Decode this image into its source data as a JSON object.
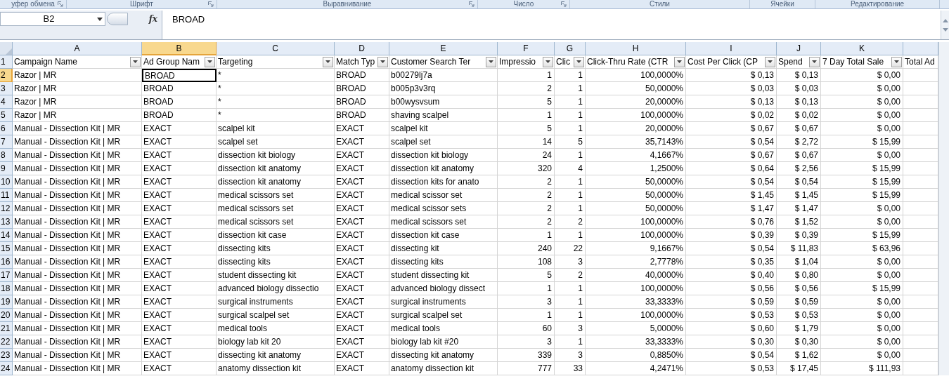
{
  "ribbon_groups": [
    {
      "label": "уфер обмена",
      "launcher": true
    },
    {
      "label": "Шрифт",
      "launcher": true
    },
    {
      "label": "Выравнивание",
      "launcher": true
    },
    {
      "label": "Число",
      "launcher": true
    },
    {
      "label": "Стили",
      "launcher": false
    },
    {
      "label": "Ячейки",
      "launcher": false
    },
    {
      "label": "Редактирование",
      "launcher": false
    }
  ],
  "formula_bar": {
    "name_box": "B2",
    "fx": "fx",
    "formula": "BROAD"
  },
  "columns": [
    {
      "letter": "A",
      "selected": false
    },
    {
      "letter": "B",
      "selected": true
    },
    {
      "letter": "C",
      "selected": false
    },
    {
      "letter": "D",
      "selected": false
    },
    {
      "letter": "E",
      "selected": false
    },
    {
      "letter": "F",
      "selected": false
    },
    {
      "letter": "G",
      "selected": false
    },
    {
      "letter": "H",
      "selected": false
    },
    {
      "letter": "I",
      "selected": false
    },
    {
      "letter": "J",
      "selected": false
    },
    {
      "letter": "K",
      "selected": false
    }
  ],
  "header_row": {
    "number": "1",
    "cells": [
      "Campaign Name",
      "Ad Group Nam",
      "Targeting",
      "Match Typ",
      "Customer Search Ter",
      "Impressio",
      "Clic",
      "Click-Thru Rate (CTR",
      "Cost Per Click (CP",
      "Spend",
      "7 Day Total Sale",
      "Total Ad"
    ]
  },
  "rows": [
    {
      "number": "2",
      "selected": true,
      "cells": [
        "Razor | MR",
        "BROAD",
        "*",
        "BROAD",
        "b00279lj7a",
        "1",
        "1",
        "100,0000%",
        "$ 0,13",
        "$ 0,13",
        "$ 0,00"
      ]
    },
    {
      "number": "3",
      "selected": false,
      "cells": [
        "Razor | MR",
        "BROAD",
        "*",
        "BROAD",
        "b005p3v3rq",
        "2",
        "1",
        "50,0000%",
        "$ 0,03",
        "$ 0,03",
        "$ 0,00"
      ]
    },
    {
      "number": "4",
      "selected": false,
      "cells": [
        "Razor | MR",
        "BROAD",
        "*",
        "BROAD",
        "b00wysvsum",
        "5",
        "1",
        "20,0000%",
        "$ 0,13",
        "$ 0,13",
        "$ 0,00"
      ]
    },
    {
      "number": "5",
      "selected": false,
      "cells": [
        "Razor | MR",
        "BROAD",
        "*",
        "BROAD",
        "shaving scalpel",
        "1",
        "1",
        "100,0000%",
        "$ 0,02",
        "$ 0,02",
        "$ 0,00"
      ]
    },
    {
      "number": "6",
      "selected": false,
      "cells": [
        "Manual - Dissection Kit | MR",
        "EXACT",
        "scalpel kit",
        "EXACT",
        "scalpel kit",
        "5",
        "1",
        "20,0000%",
        "$ 0,67",
        "$ 0,67",
        "$ 0,00"
      ]
    },
    {
      "number": "7",
      "selected": false,
      "cells": [
        "Manual - Dissection Kit | MR",
        "EXACT",
        "scalpel set",
        "EXACT",
        "scalpel set",
        "14",
        "5",
        "35,7143%",
        "$ 0,54",
        "$ 2,72",
        "$ 15,99"
      ]
    },
    {
      "number": "8",
      "selected": false,
      "cells": [
        "Manual - Dissection Kit | MR",
        "EXACT",
        "dissection kit biology",
        "EXACT",
        "dissection kit biology",
        "24",
        "1",
        "4,1667%",
        "$ 0,67",
        "$ 0,67",
        "$ 0,00"
      ]
    },
    {
      "number": "9",
      "selected": false,
      "cells": [
        "Manual - Dissection Kit | MR",
        "EXACT",
        "dissection kit anatomy",
        "EXACT",
        "dissection kit anatomy",
        "320",
        "4",
        "1,2500%",
        "$ 0,64",
        "$ 2,56",
        "$ 15,99"
      ]
    },
    {
      "number": "10",
      "selected": false,
      "cells": [
        "Manual - Dissection Kit | MR",
        "EXACT",
        "dissection kit anatomy",
        "EXACT",
        "dissection kits for anato",
        "2",
        "1",
        "50,0000%",
        "$ 0,54",
        "$ 0,54",
        "$ 15,99"
      ]
    },
    {
      "number": "11",
      "selected": false,
      "cells": [
        "Manual - Dissection Kit | MR",
        "EXACT",
        "medical scissors set",
        "EXACT",
        "medical scissor set",
        "2",
        "1",
        "50,0000%",
        "$ 1,45",
        "$ 1,45",
        "$ 15,99"
      ]
    },
    {
      "number": "12",
      "selected": false,
      "cells": [
        "Manual - Dissection Kit | MR",
        "EXACT",
        "medical scissors set",
        "EXACT",
        "medical scissor sets",
        "2",
        "1",
        "50,0000%",
        "$ 1,47",
        "$ 1,47",
        "$ 0,00"
      ]
    },
    {
      "number": "13",
      "selected": false,
      "cells": [
        "Manual - Dissection Kit | MR",
        "EXACT",
        "medical scissors set",
        "EXACT",
        "medical scissors set",
        "2",
        "2",
        "100,0000%",
        "$ 0,76",
        "$ 1,52",
        "$ 0,00"
      ]
    },
    {
      "number": "14",
      "selected": false,
      "cells": [
        "Manual - Dissection Kit | MR",
        "EXACT",
        "dissection kit case",
        "EXACT",
        "dissection kit case",
        "1",
        "1",
        "100,0000%",
        "$ 0,39",
        "$ 0,39",
        "$ 15,99"
      ]
    },
    {
      "number": "15",
      "selected": false,
      "cells": [
        "Manual - Dissection Kit | MR",
        "EXACT",
        "dissecting kits",
        "EXACT",
        "dissecting kit",
        "240",
        "22",
        "9,1667%",
        "$ 0,54",
        "$ 11,83",
        "$ 63,96"
      ]
    },
    {
      "number": "16",
      "selected": false,
      "cells": [
        "Manual - Dissection Kit | MR",
        "EXACT",
        "dissecting kits",
        "EXACT",
        "dissecting kits",
        "108",
        "3",
        "2,7778%",
        "$ 0,35",
        "$ 1,04",
        "$ 0,00"
      ]
    },
    {
      "number": "17",
      "selected": false,
      "cells": [
        "Manual - Dissection Kit | MR",
        "EXACT",
        "student dissecting kit",
        "EXACT",
        "student dissecting kit",
        "5",
        "2",
        "40,0000%",
        "$ 0,40",
        "$ 0,80",
        "$ 0,00"
      ]
    },
    {
      "number": "18",
      "selected": false,
      "cells": [
        "Manual - Dissection Kit | MR",
        "EXACT",
        "advanced biology dissectio",
        "EXACT",
        "advanced biology dissect",
        "1",
        "1",
        "100,0000%",
        "$ 0,56",
        "$ 0,56",
        "$ 15,99"
      ]
    },
    {
      "number": "19",
      "selected": false,
      "cells": [
        "Manual - Dissection Kit | MR",
        "EXACT",
        "surgical instruments",
        "EXACT",
        "surgical instruments",
        "3",
        "1",
        "33,3333%",
        "$ 0,59",
        "$ 0,59",
        "$ 0,00"
      ]
    },
    {
      "number": "20",
      "selected": false,
      "cells": [
        "Manual - Dissection Kit | MR",
        "EXACT",
        "surgical scalpel set",
        "EXACT",
        "surgical scalpel set",
        "1",
        "1",
        "100,0000%",
        "$ 0,53",
        "$ 0,53",
        "$ 0,00"
      ]
    },
    {
      "number": "21",
      "selected": false,
      "cells": [
        "Manual - Dissection Kit | MR",
        "EXACT",
        "medical tools",
        "EXACT",
        "medical tools",
        "60",
        "3",
        "5,0000%",
        "$ 0,60",
        "$ 1,79",
        "$ 0,00"
      ]
    },
    {
      "number": "22",
      "selected": false,
      "cells": [
        "Manual - Dissection Kit | MR",
        "EXACT",
        "biology lab kit 20",
        "EXACT",
        "biology lab kit #20",
        "3",
        "1",
        "33,3333%",
        "$ 0,30",
        "$ 0,30",
        "$ 0,00"
      ]
    },
    {
      "number": "23",
      "selected": false,
      "cells": [
        "Manual - Dissection Kit | MR",
        "EXACT",
        "dissecting kit anatomy",
        "EXACT",
        "dissecting kit anatomy",
        "339",
        "3",
        "0,8850%",
        "$ 0,54",
        "$ 1,62",
        "$ 0,00"
      ]
    },
    {
      "number": "24",
      "selected": false,
      "cells": [
        "Manual - Dissection Kit | MR",
        "EXACT",
        "anatomy dissection kit",
        "EXACT",
        "anatomy dissection kit",
        "777",
        "33",
        "4,2471%",
        "$ 0,53",
        "$ 17,45",
        "$ 111,93"
      ]
    }
  ]
}
